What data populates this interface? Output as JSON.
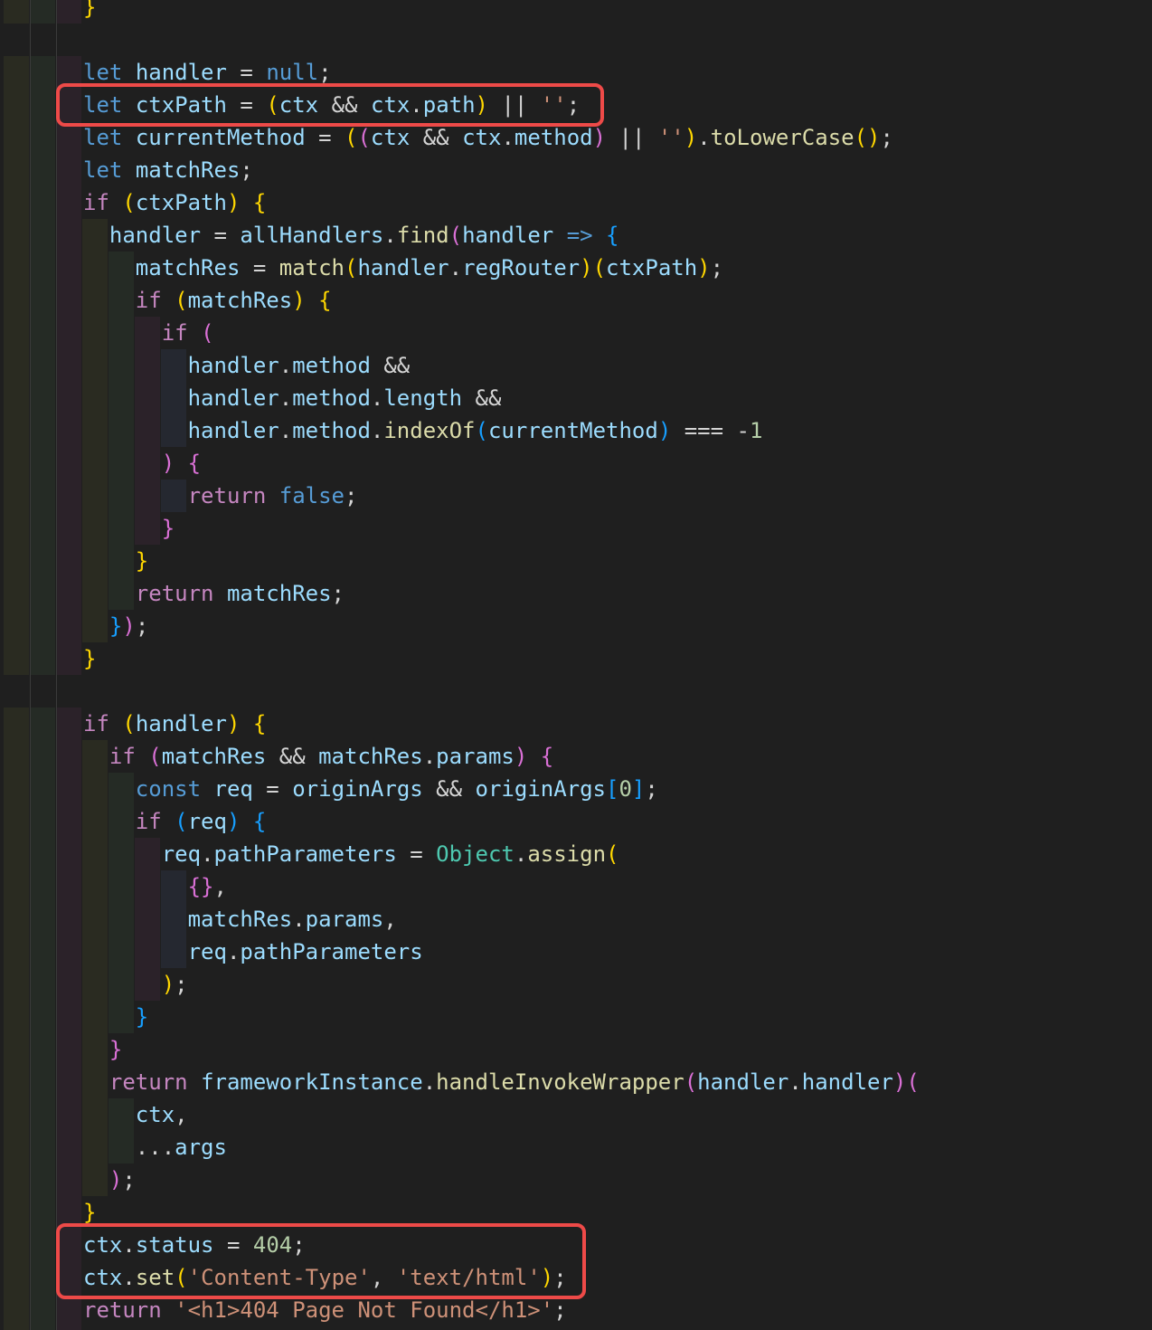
{
  "colors": {
    "background": "#1f1f1f",
    "keyword": "#569cd6",
    "control": "#c586c0",
    "variable": "#9cdcfe",
    "function": "#dcdcaa",
    "string": "#ce9178",
    "number": "#b5cea8",
    "class": "#4ec9b0",
    "operator": "#d4d4d4",
    "bracket1": "#ffd700",
    "bracket2": "#da70d6",
    "bracket3": "#179fff",
    "highlight_box": "#ee4a48"
  },
  "code_lines": [
    [
      [
        "}",
        "bracket1"
      ]
    ],
    [],
    [
      [
        "let",
        "keyword"
      ],
      [
        " ",
        "operator"
      ],
      [
        "handler",
        "variable"
      ],
      [
        " = ",
        "operator"
      ],
      [
        "null",
        "keyword"
      ],
      [
        ";",
        "operator"
      ]
    ],
    [
      [
        "let",
        "keyword"
      ],
      [
        " ",
        "operator"
      ],
      [
        "ctxPath",
        "variable"
      ],
      [
        " = ",
        "operator"
      ],
      [
        "(",
        "bracket1"
      ],
      [
        "ctx",
        "variable"
      ],
      [
        " && ",
        "operator"
      ],
      [
        "ctx",
        "variable"
      ],
      [
        ".",
        "operator"
      ],
      [
        "path",
        "variable"
      ],
      [
        ")",
        "bracket1"
      ],
      [
        " || ",
        "operator"
      ],
      [
        "''",
        "string"
      ],
      [
        ";",
        "operator"
      ]
    ],
    [
      [
        "let",
        "keyword"
      ],
      [
        " ",
        "operator"
      ],
      [
        "currentMethod",
        "variable"
      ],
      [
        " = ",
        "operator"
      ],
      [
        "(",
        "bracket1"
      ],
      [
        "(",
        "bracket2"
      ],
      [
        "ctx",
        "variable"
      ],
      [
        " && ",
        "operator"
      ],
      [
        "ctx",
        "variable"
      ],
      [
        ".",
        "operator"
      ],
      [
        "method",
        "variable"
      ],
      [
        ")",
        "bracket2"
      ],
      [
        " || ",
        "operator"
      ],
      [
        "''",
        "string"
      ],
      [
        ")",
        "bracket1"
      ],
      [
        ".",
        "operator"
      ],
      [
        "toLowerCase",
        "function"
      ],
      [
        "()",
        "bracket1"
      ],
      [
        ";",
        "operator"
      ]
    ],
    [
      [
        "let",
        "keyword"
      ],
      [
        " ",
        "operator"
      ],
      [
        "matchRes",
        "variable"
      ],
      [
        ";",
        "operator"
      ]
    ],
    [
      [
        "if",
        "control"
      ],
      [
        " ",
        "operator"
      ],
      [
        "(",
        "bracket1"
      ],
      [
        "ctxPath",
        "variable"
      ],
      [
        ")",
        "bracket1"
      ],
      [
        " ",
        "operator"
      ],
      [
        "{",
        "bracket1"
      ]
    ],
    [
      [
        "  ",
        "operator"
      ],
      [
        "handler",
        "variable"
      ],
      [
        " = ",
        "operator"
      ],
      [
        "allHandlers",
        "variable"
      ],
      [
        ".",
        "operator"
      ],
      [
        "find",
        "function"
      ],
      [
        "(",
        "bracket2"
      ],
      [
        "handler",
        "variable"
      ],
      [
        " ",
        "operator"
      ],
      [
        "=>",
        "keyword"
      ],
      [
        " ",
        "operator"
      ],
      [
        "{",
        "bracket3"
      ]
    ],
    [
      [
        "    ",
        "operator"
      ],
      [
        "matchRes",
        "variable"
      ],
      [
        " = ",
        "operator"
      ],
      [
        "match",
        "function"
      ],
      [
        "(",
        "bracket1"
      ],
      [
        "handler",
        "variable"
      ],
      [
        ".",
        "operator"
      ],
      [
        "regRouter",
        "variable"
      ],
      [
        ")",
        "bracket1"
      ],
      [
        "(",
        "bracket1"
      ],
      [
        "ctxPath",
        "variable"
      ],
      [
        ")",
        "bracket1"
      ],
      [
        ";",
        "operator"
      ]
    ],
    [
      [
        "    ",
        "operator"
      ],
      [
        "if",
        "control"
      ],
      [
        " ",
        "operator"
      ],
      [
        "(",
        "bracket1"
      ],
      [
        "matchRes",
        "variable"
      ],
      [
        ")",
        "bracket1"
      ],
      [
        " ",
        "operator"
      ],
      [
        "{",
        "bracket1"
      ]
    ],
    [
      [
        "      ",
        "operator"
      ],
      [
        "if",
        "control"
      ],
      [
        " ",
        "operator"
      ],
      [
        "(",
        "bracket2"
      ]
    ],
    [
      [
        "        ",
        "operator"
      ],
      [
        "handler",
        "variable"
      ],
      [
        ".",
        "operator"
      ],
      [
        "method",
        "variable"
      ],
      [
        " &&",
        "operator"
      ]
    ],
    [
      [
        "        ",
        "operator"
      ],
      [
        "handler",
        "variable"
      ],
      [
        ".",
        "operator"
      ],
      [
        "method",
        "variable"
      ],
      [
        ".",
        "operator"
      ],
      [
        "length",
        "variable"
      ],
      [
        " &&",
        "operator"
      ]
    ],
    [
      [
        "        ",
        "operator"
      ],
      [
        "handler",
        "variable"
      ],
      [
        ".",
        "operator"
      ],
      [
        "method",
        "variable"
      ],
      [
        ".",
        "operator"
      ],
      [
        "indexOf",
        "function"
      ],
      [
        "(",
        "bracket3"
      ],
      [
        "currentMethod",
        "variable"
      ],
      [
        ")",
        "bracket3"
      ],
      [
        " === -",
        "operator"
      ],
      [
        "1",
        "number"
      ]
    ],
    [
      [
        "      ",
        "operator"
      ],
      [
        ")",
        "bracket2"
      ],
      [
        " ",
        "operator"
      ],
      [
        "{",
        "bracket2"
      ]
    ],
    [
      [
        "        ",
        "operator"
      ],
      [
        "return",
        "control"
      ],
      [
        " ",
        "operator"
      ],
      [
        "false",
        "keyword"
      ],
      [
        ";",
        "operator"
      ]
    ],
    [
      [
        "      ",
        "operator"
      ],
      [
        "}",
        "bracket2"
      ]
    ],
    [
      [
        "    ",
        "operator"
      ],
      [
        "}",
        "bracket1"
      ]
    ],
    [
      [
        "    ",
        "operator"
      ],
      [
        "return",
        "control"
      ],
      [
        " ",
        "operator"
      ],
      [
        "matchRes",
        "variable"
      ],
      [
        ";",
        "operator"
      ]
    ],
    [
      [
        "  ",
        "operator"
      ],
      [
        "}",
        "bracket3"
      ],
      [
        ")",
        "bracket2"
      ],
      [
        ";",
        "operator"
      ]
    ],
    [
      [
        "}",
        "bracket1"
      ]
    ],
    [],
    [
      [
        "if",
        "control"
      ],
      [
        " ",
        "operator"
      ],
      [
        "(",
        "bracket1"
      ],
      [
        "handler",
        "variable"
      ],
      [
        ")",
        "bracket1"
      ],
      [
        " ",
        "operator"
      ],
      [
        "{",
        "bracket1"
      ]
    ],
    [
      [
        "  ",
        "operator"
      ],
      [
        "if",
        "control"
      ],
      [
        " ",
        "operator"
      ],
      [
        "(",
        "bracket2"
      ],
      [
        "matchRes",
        "variable"
      ],
      [
        " && ",
        "operator"
      ],
      [
        "matchRes",
        "variable"
      ],
      [
        ".",
        "operator"
      ],
      [
        "params",
        "variable"
      ],
      [
        ")",
        "bracket2"
      ],
      [
        " ",
        "operator"
      ],
      [
        "{",
        "bracket2"
      ]
    ],
    [
      [
        "    ",
        "operator"
      ],
      [
        "const",
        "keyword"
      ],
      [
        " ",
        "operator"
      ],
      [
        "req",
        "variable"
      ],
      [
        " = ",
        "operator"
      ],
      [
        "originArgs",
        "variable"
      ],
      [
        " && ",
        "operator"
      ],
      [
        "originArgs",
        "variable"
      ],
      [
        "[",
        "bracket3"
      ],
      [
        "0",
        "number"
      ],
      [
        "]",
        "bracket3"
      ],
      [
        ";",
        "operator"
      ]
    ],
    [
      [
        "    ",
        "operator"
      ],
      [
        "if",
        "control"
      ],
      [
        " ",
        "operator"
      ],
      [
        "(",
        "bracket3"
      ],
      [
        "req",
        "variable"
      ],
      [
        ")",
        "bracket3"
      ],
      [
        " ",
        "operator"
      ],
      [
        "{",
        "bracket3"
      ]
    ],
    [
      [
        "      ",
        "operator"
      ],
      [
        "req",
        "variable"
      ],
      [
        ".",
        "operator"
      ],
      [
        "pathParameters",
        "variable"
      ],
      [
        " = ",
        "operator"
      ],
      [
        "Object",
        "class"
      ],
      [
        ".",
        "operator"
      ],
      [
        "assign",
        "function"
      ],
      [
        "(",
        "bracket1"
      ]
    ],
    [
      [
        "        ",
        "operator"
      ],
      [
        "{}",
        "bracket2"
      ],
      [
        ",",
        "operator"
      ]
    ],
    [
      [
        "        ",
        "operator"
      ],
      [
        "matchRes",
        "variable"
      ],
      [
        ".",
        "operator"
      ],
      [
        "params",
        "variable"
      ],
      [
        ",",
        "operator"
      ]
    ],
    [
      [
        "        ",
        "operator"
      ],
      [
        "req",
        "variable"
      ],
      [
        ".",
        "operator"
      ],
      [
        "pathParameters",
        "variable"
      ]
    ],
    [
      [
        "      ",
        "operator"
      ],
      [
        ")",
        "bracket1"
      ],
      [
        ";",
        "operator"
      ]
    ],
    [
      [
        "    ",
        "operator"
      ],
      [
        "}",
        "bracket3"
      ]
    ],
    [
      [
        "  ",
        "operator"
      ],
      [
        "}",
        "bracket2"
      ]
    ],
    [
      [
        "  ",
        "operator"
      ],
      [
        "return",
        "control"
      ],
      [
        " ",
        "operator"
      ],
      [
        "frameworkInstance",
        "variable"
      ],
      [
        ".",
        "operator"
      ],
      [
        "handleInvokeWrapper",
        "function"
      ],
      [
        "(",
        "bracket2"
      ],
      [
        "handler",
        "variable"
      ],
      [
        ".",
        "operator"
      ],
      [
        "handler",
        "variable"
      ],
      [
        ")",
        "bracket2"
      ],
      [
        "(",
        "bracket2"
      ]
    ],
    [
      [
        "    ",
        "operator"
      ],
      [
        "ctx",
        "variable"
      ],
      [
        ",",
        "operator"
      ]
    ],
    [
      [
        "    ",
        "operator"
      ],
      [
        "...",
        "operator"
      ],
      [
        "args",
        "variable"
      ]
    ],
    [
      [
        "  ",
        "operator"
      ],
      [
        ")",
        "bracket2"
      ],
      [
        ";",
        "operator"
      ]
    ],
    [
      [
        "}",
        "bracket1"
      ]
    ],
    [
      [
        "ctx",
        "variable"
      ],
      [
        ".",
        "operator"
      ],
      [
        "status",
        "variable"
      ],
      [
        " = ",
        "operator"
      ],
      [
        "404",
        "number"
      ],
      [
        ";",
        "operator"
      ]
    ],
    [
      [
        "ctx",
        "variable"
      ],
      [
        ".",
        "operator"
      ],
      [
        "set",
        "function"
      ],
      [
        "(",
        "bracket1"
      ],
      [
        "'Content-Type'",
        "string"
      ],
      [
        ", ",
        "operator"
      ],
      [
        "'text/html'",
        "string"
      ],
      [
        ")",
        "bracket1"
      ],
      [
        ";",
        "operator"
      ]
    ],
    [
      [
        "return",
        "control"
      ],
      [
        " ",
        "operator"
      ],
      [
        "'<h1>404 Page Not Found</h1>'",
        "string"
      ],
      [
        ";",
        "operator"
      ]
    ]
  ],
  "highlight_boxes": [
    {
      "first_line": 3,
      "last_line": 3
    },
    {
      "first_line": 38,
      "last_line": 39
    }
  ]
}
